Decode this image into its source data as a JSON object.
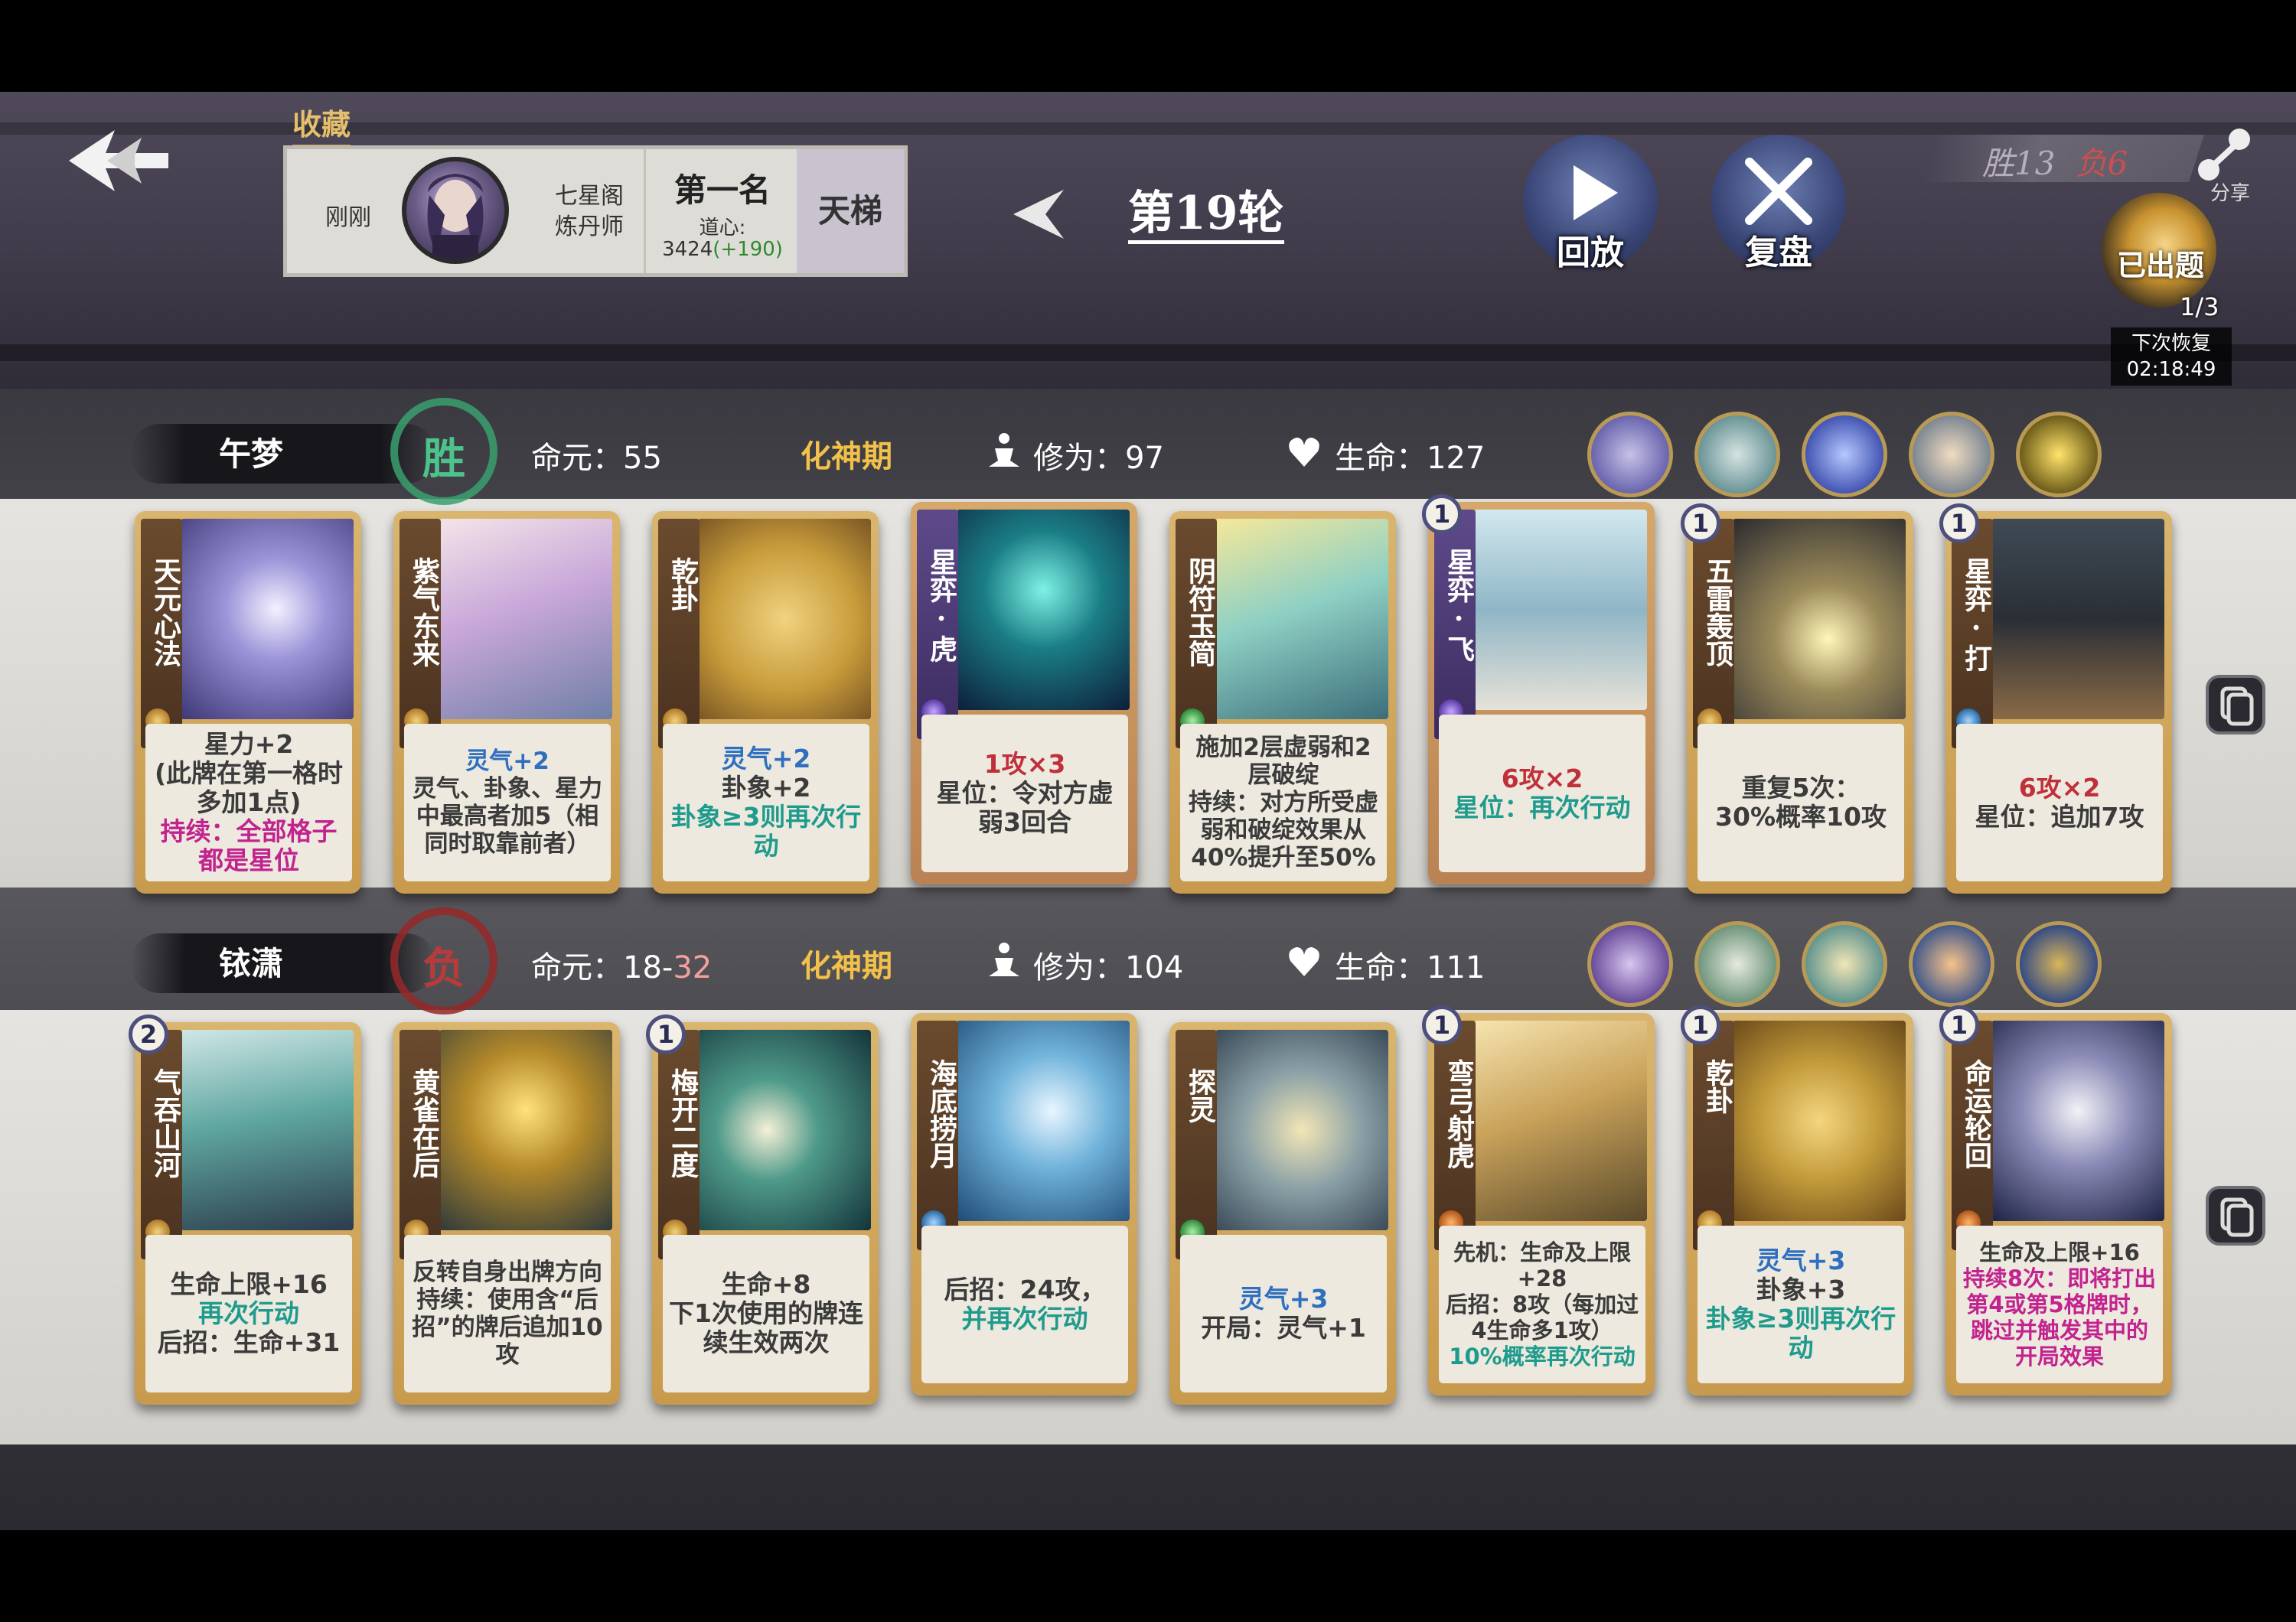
{
  "header": {
    "collect_label": "收藏",
    "player": {
      "time": "刚刚",
      "sect_line1": "七星阁",
      "sect_line2": "炼丹师",
      "rank": "第一名",
      "dao_label": "道心:",
      "score": "3424",
      "score_gain": "(+190)",
      "mode": "天梯"
    },
    "round": "第19轮",
    "replay_label": "回放",
    "review_label": "复盘",
    "record_win": "胜13",
    "record_lose": "负6",
    "share_label": "分享",
    "quest_title": "已出题",
    "quest_count": "1/3",
    "quest_next": "下次恢复",
    "quest_timer": "02:18:49"
  },
  "players": [
    {
      "name": "午梦",
      "result": "胜",
      "life_label": "命元：",
      "life_value": "55",
      "life_max": "",
      "realm": "化神期",
      "cultivation_label": "修为：",
      "cultivation": "97",
      "hp_label": "生命：",
      "hp": "127",
      "badges": [
        "scroll",
        "flag",
        "spiral",
        "monk",
        "lightning"
      ],
      "cards": [
        {
          "name": "天元心法",
          "cost": "",
          "desc": [
            "星力+2",
            "(此牌在第一格时多加1点)",
            "持续：全部格子都是星位"
          ]
        },
        {
          "name": "紫气东来",
          "cost": "",
          "desc": [
            "灵气+2",
            "灵气、卦象、星力中最高者加5（相同时取靠前者）"
          ]
        },
        {
          "name": "乾卦",
          "cost": "",
          "desc": [
            "灵气+2",
            "卦象+2",
            "卦象≥3则再次行动"
          ]
        },
        {
          "name": "星弈·虎",
          "cost": "",
          "desc": [
            "1攻×3",
            "星位：令对方虚弱3回合"
          ]
        },
        {
          "name": "阴符玉简",
          "cost": "",
          "desc": [
            "施加2层虚弱和2层破绽",
            "持续：对方所受虚弱和破绽效果从40%提升至50%"
          ]
        },
        {
          "name": "星弈·飞",
          "cost": "1",
          "desc": [
            "6攻×2",
            "星位：再次行动"
          ]
        },
        {
          "name": "五雷轰顶",
          "cost": "1",
          "desc": [
            "重复5次：",
            "30%概率10攻"
          ]
        },
        {
          "name": "星弈·打",
          "cost": "1",
          "desc": [
            "6攻×2",
            "星位：追加7攻"
          ]
        }
      ]
    },
    {
      "name": "铱潇",
      "result": "负",
      "life_label": "命元：",
      "life_value": "18",
      "life_max": "32",
      "realm": "化神期",
      "cultivation_label": "修为：",
      "cultivation": "104",
      "hp_label": "生命：",
      "hp": "111",
      "badges": [
        "gourd",
        "scholar",
        "sage",
        "moon",
        "yinyang"
      ],
      "cards": [
        {
          "name": "气吞山河",
          "cost": "2",
          "desc": [
            "生命上限+16",
            "再次行动",
            "后招：生命+31"
          ]
        },
        {
          "name": "黄雀在后",
          "cost": "",
          "desc": [
            "反转自身出牌方向",
            "持续：使用含“后招”的牌后追加10攻"
          ]
        },
        {
          "name": "梅开二度",
          "cost": "1",
          "desc": [
            "生命+8",
            "下1次使用的牌连续生效两次"
          ]
        },
        {
          "name": "海底捞月",
          "cost": "",
          "desc": [
            "后招：24攻，",
            "并再次行动"
          ]
        },
        {
          "name": "探灵",
          "cost": "",
          "desc": [
            "灵气+3",
            "开局：灵气+1"
          ]
        },
        {
          "name": "弯弓射虎",
          "cost": "1",
          "desc": [
            "先机：生命及上限+28",
            "后招：8攻（每加过4生命多1攻）",
            "10%概率再次行动"
          ]
        },
        {
          "name": "乾卦",
          "cost": "1",
          "desc": [
            "灵气+3",
            "卦象+3",
            "卦象≥3则再次行动"
          ]
        },
        {
          "name": "命运轮回",
          "cost": "1",
          "desc": [
            "生命及上限+16",
            "持续8次：即将打出第4或第5格牌时，跳过并触发其中的开局效果"
          ]
        }
      ]
    }
  ]
}
